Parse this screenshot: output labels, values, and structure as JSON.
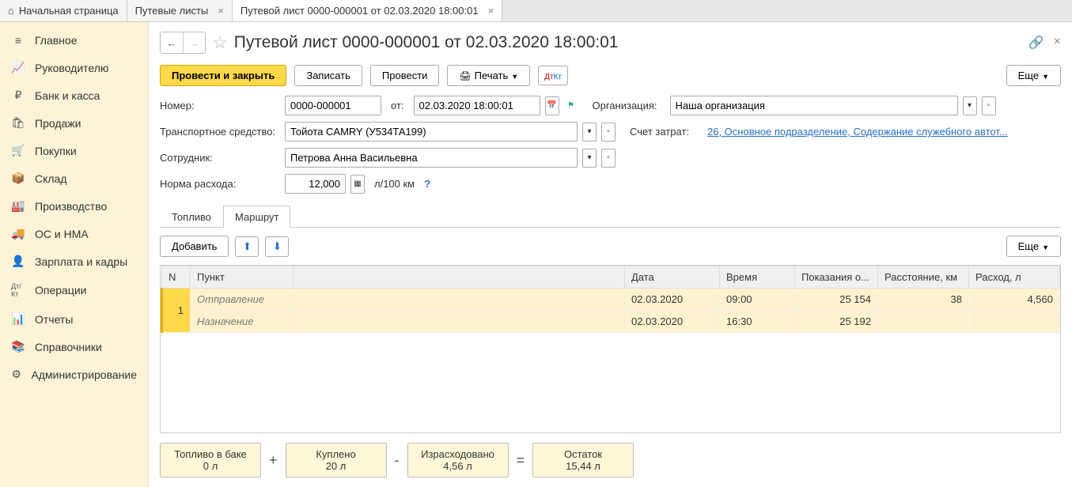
{
  "tabs": [
    {
      "label": "Начальная страница",
      "icon": "home"
    },
    {
      "label": "Путевые листы",
      "closable": true
    },
    {
      "label": "Путевой лист 0000-000001 от 02.03.2020 18:00:01",
      "closable": true,
      "active": true
    }
  ],
  "sidebar": [
    {
      "icon": "≡",
      "label": "Главное"
    },
    {
      "icon": "📈",
      "label": "Руководителю"
    },
    {
      "icon": "₽",
      "label": "Банк и касса"
    },
    {
      "icon": "🛍",
      "label": "Продажи"
    },
    {
      "icon": "🛒",
      "label": "Покупки"
    },
    {
      "icon": "📦",
      "label": "Склад"
    },
    {
      "icon": "🏭",
      "label": "Производство"
    },
    {
      "icon": "🚚",
      "label": "ОС и НМА"
    },
    {
      "icon": "👤",
      "label": "Зарплата и кадры"
    },
    {
      "icon": "Дт/Кт",
      "label": "Операции"
    },
    {
      "icon": "📊",
      "label": "Отчеты"
    },
    {
      "icon": "📚",
      "label": "Справочники"
    },
    {
      "icon": "⚙",
      "label": "Администрирование"
    }
  ],
  "title": "Путевой лист 0000-000001 от 02.03.2020 18:00:01",
  "toolbar": {
    "post_and_close": "Провести и закрыть",
    "save": "Записать",
    "post": "Провести",
    "print": "Печать",
    "more": "Еще"
  },
  "form": {
    "number_label": "Номер:",
    "number": "0000-000001",
    "from_label": "от:",
    "date": "02.03.2020 18:00:01",
    "org_label": "Организация:",
    "org": "Наша организация",
    "vehicle_label": "Транспортное средство:",
    "vehicle": "Тойота CAMRY (У534ТА199)",
    "cost_label": "Счет затрат:",
    "cost_link": "26, Основное подразделение, Содержание служебного автот...",
    "employee_label": "Сотрудник:",
    "employee": "Петрова Анна Васильевна",
    "consumption_label": "Норма расхода:",
    "consumption": "12,000",
    "consumption_unit": "л/100 км"
  },
  "doc_tabs": {
    "fuel": "Топливо",
    "route": "Маршрут"
  },
  "table_toolbar": {
    "add": "Добавить",
    "more": "Еще"
  },
  "table": {
    "headers": {
      "n": "N",
      "point": "Пункт",
      "date": "Дата",
      "time": "Время",
      "odo": "Показания о...",
      "dist": "Расстояние, км",
      "cons": "Расход, л"
    },
    "rows": [
      {
        "n": "1",
        "sub": "Отправление",
        "date": "02.03.2020",
        "time": "09:00",
        "odo": "25 154",
        "dist": "38",
        "cons": "4,560"
      },
      {
        "n": "",
        "sub": "Назначение",
        "date": "02.03.2020",
        "time": "16:30",
        "odo": "25 192",
        "dist": "",
        "cons": ""
      }
    ]
  },
  "summary": {
    "tank_label": "Топливо в баке",
    "tank_val": "0 л",
    "bought_label": "Куплено",
    "bought_val": "20 л",
    "spent_label": "Израсходовано",
    "spent_val": "4,56 л",
    "rest_label": "Остаток",
    "rest_val": "15,44 л"
  }
}
